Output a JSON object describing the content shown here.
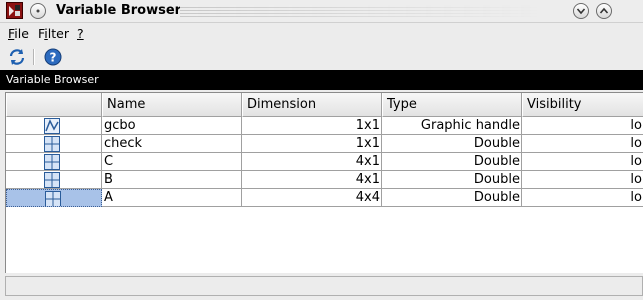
{
  "window": {
    "title": "Variable Browser",
    "icons": {
      "app": "scilab-icon",
      "menu": "window-menu-icon",
      "minimize": "minimize-icon",
      "maximize": "maximize-icon"
    }
  },
  "menubar": {
    "items": [
      {
        "mnemonic": "F",
        "rest": "ile"
      },
      {
        "mnemonic": "",
        "pre": "F",
        "mn": "i",
        "rest": "lter"
      },
      {
        "mnemonic": "?",
        "rest": ""
      }
    ]
  },
  "toolbar": {
    "buttons": [
      {
        "icon": "refresh-icon"
      },
      {
        "icon": "help-icon"
      }
    ]
  },
  "panel": {
    "title": "Variable Browser"
  },
  "table": {
    "columns": [
      "",
      "Name",
      "Dimension",
      "Type",
      "Visibility"
    ],
    "rows": [
      {
        "icon": "graphic-handle-icon",
        "name": "gcbo",
        "dimension": "1x1",
        "type": "Graphic handle",
        "visibility": "lo",
        "selected": false
      },
      {
        "icon": "matrix-icon",
        "name": "check",
        "dimension": "1x1",
        "type": "Double",
        "visibility": "lo",
        "selected": false
      },
      {
        "icon": "matrix-icon",
        "name": "C",
        "dimension": "4x1",
        "type": "Double",
        "visibility": "lo",
        "selected": false
      },
      {
        "icon": "matrix-icon",
        "name": "B",
        "dimension": "4x1",
        "type": "Double",
        "visibility": "lo",
        "selected": false
      },
      {
        "icon": "matrix-icon",
        "name": "A",
        "dimension": "4x4",
        "type": "Double",
        "visibility": "lo",
        "selected": true
      }
    ]
  },
  "colors": {
    "selection": "#c4d6f0",
    "panel_header_bg": "#000000",
    "icon_blue": "#2a5c9a"
  }
}
